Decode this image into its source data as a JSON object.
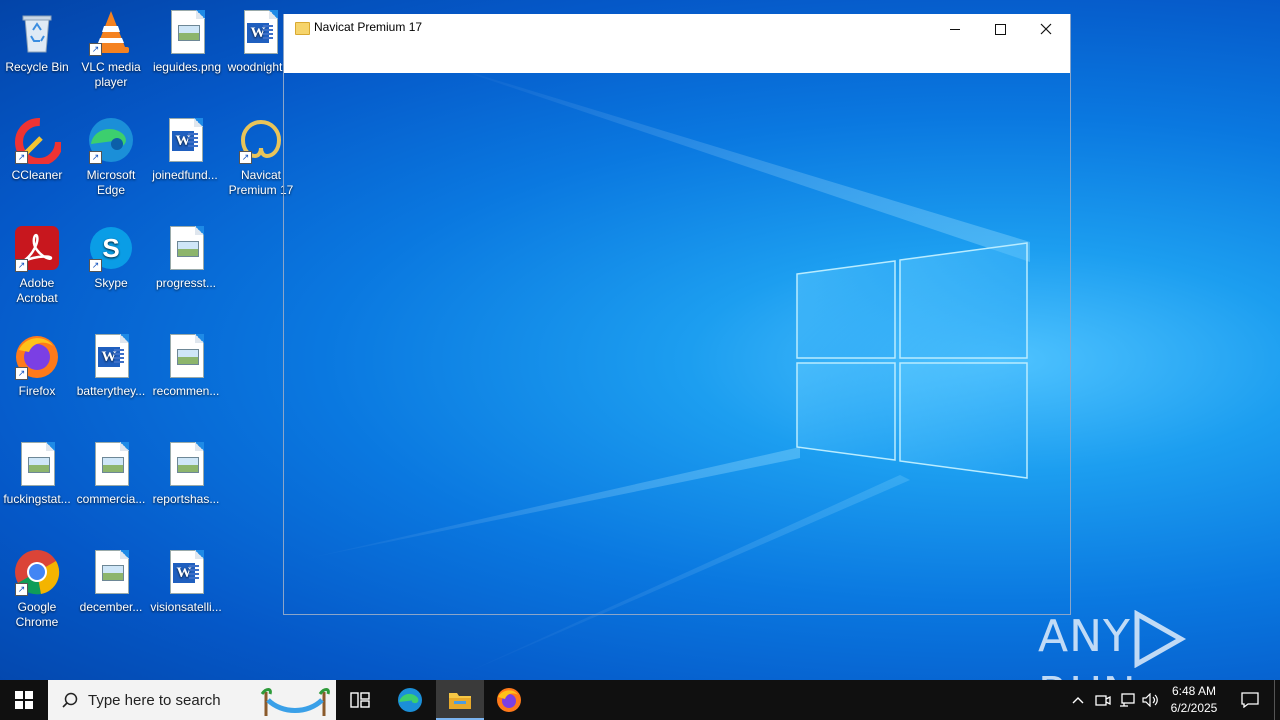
{
  "desktop": {
    "icons": [
      {
        "label": "Recycle Bin"
      },
      {
        "label": "VLC media player"
      },
      {
        "label": "ieguides.png"
      },
      {
        "label": "woodnight..."
      },
      {
        "label": "CCleaner"
      },
      {
        "label": "Microsoft Edge"
      },
      {
        "label": "joinedfund..."
      },
      {
        "label": "Navicat Premium 17"
      },
      {
        "label": "Adobe Acrobat"
      },
      {
        "label": "Skype"
      },
      {
        "label": "progresst..."
      },
      {
        "label": "Firefox"
      },
      {
        "label": "batterythey..."
      },
      {
        "label": "recommen..."
      },
      {
        "label": "fuckingstat..."
      },
      {
        "label": "commercia..."
      },
      {
        "label": "reportshas..."
      },
      {
        "label": "Google Chrome"
      },
      {
        "label": "december..."
      },
      {
        "label": "visionsatelli..."
      }
    ]
  },
  "window": {
    "title": "Navicat Premium 17",
    "minimize_icon": "minimize-icon",
    "maximize_icon": "maximize-icon",
    "close_icon": "close-icon"
  },
  "watermark": {
    "text_left": "ANY",
    "text_right": "RUN"
  },
  "taskbar": {
    "search_placeholder": "Type here to search",
    "apps": [
      "task-view",
      "microsoft-edge",
      "file-explorer",
      "firefox"
    ],
    "clock_time": "6:48 AM",
    "clock_date": "6/2/2025"
  },
  "colors": {
    "taskbar": "#101010",
    "desktop_accent": "#0a78e0",
    "search_bg": "#f3f3f3"
  }
}
